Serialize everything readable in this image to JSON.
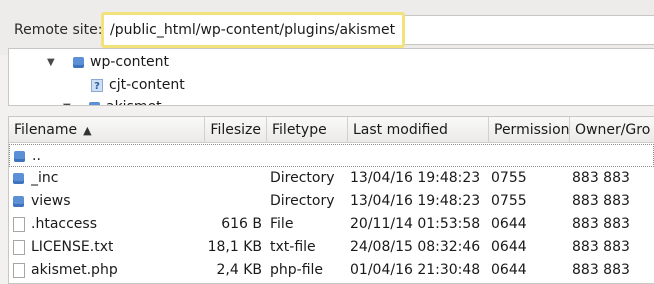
{
  "remote": {
    "label": "Remote site:",
    "path": "/public_html/wp-content/plugins/akismet"
  },
  "tree": {
    "items": [
      {
        "label": "wp-content",
        "expander": "▼",
        "icon": "folder-icon"
      },
      {
        "label": "cjt-content",
        "expander": "",
        "icon": "unknown-folder-icon"
      },
      {
        "label": "akismet",
        "expander": "▼",
        "icon": "folder-icon"
      }
    ]
  },
  "list": {
    "columns": [
      {
        "label": "Filename",
        "sort": "▲"
      },
      {
        "label": "Filesize"
      },
      {
        "label": "Filetype"
      },
      {
        "label": "Last modified"
      },
      {
        "label": "Permission"
      },
      {
        "label": "Owner/Gro"
      }
    ],
    "rows": [
      {
        "name": "..",
        "size": "",
        "type": "",
        "modified": "",
        "perm": "",
        "owner": "",
        "icon": "folder-icon"
      },
      {
        "name": "_inc",
        "size": "",
        "type": "Directory",
        "modified": "13/04/16 19:48:23",
        "perm": "0755",
        "owner": "883 883",
        "icon": "folder-icon"
      },
      {
        "name": "views",
        "size": "",
        "type": "Directory",
        "modified": "13/04/16 19:48:23",
        "perm": "0755",
        "owner": "883 883",
        "icon": "folder-icon"
      },
      {
        "name": ".htaccess",
        "size": "616 B",
        "type": "File",
        "modified": "20/11/14 01:53:58",
        "perm": "0644",
        "owner": "883 883",
        "icon": "file-icon"
      },
      {
        "name": "LICENSE.txt",
        "size": "18,1 KB",
        "type": "txt-file",
        "modified": "24/08/15 08:32:46",
        "perm": "0644",
        "owner": "883 883",
        "icon": "file-icon"
      },
      {
        "name": "akismet.php",
        "size": "2,4 KB",
        "type": "php-file",
        "modified": "01/04/16 21:30:48",
        "perm": "0644",
        "owner": "883 883",
        "icon": "file-icon"
      }
    ]
  },
  "colors": {
    "accent_border": "#f3e27a",
    "folder": "#5b8fd6"
  }
}
